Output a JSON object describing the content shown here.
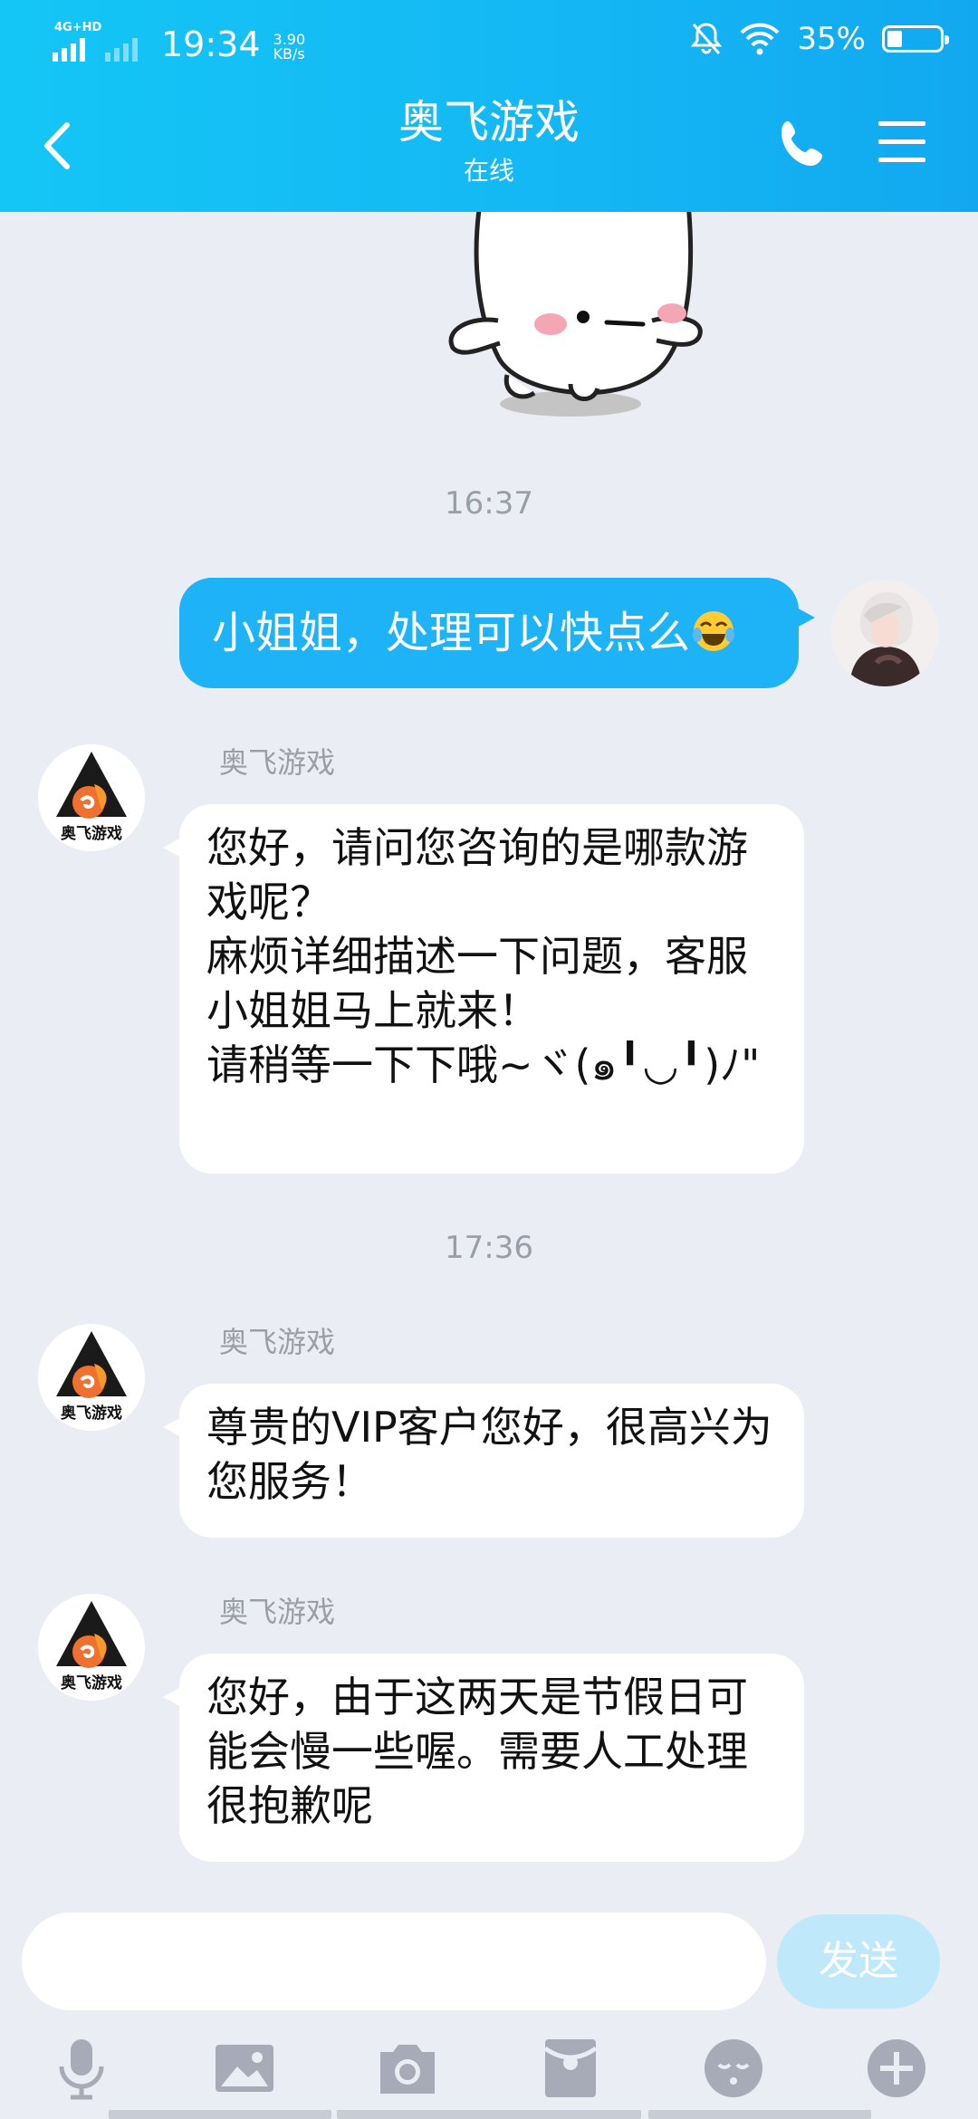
{
  "status_bar": {
    "network_label": "4G+HD",
    "time": "19:34",
    "speed_value": "3.90",
    "speed_unit": "KB/s",
    "battery_percent": "35%",
    "battery_level": 0.35
  },
  "header": {
    "title": "奥飞游戏",
    "subtitle": "在线"
  },
  "messages": [
    {
      "type": "timestamp",
      "text": "16:37"
    },
    {
      "type": "outgoing",
      "text": "小姐姐，处理可以快点么",
      "emoji": "joy-tears-emoji"
    },
    {
      "type": "incoming",
      "sender": "奥飞游戏",
      "text": "您好，请问您咨询的是哪款游戏呢？\n麻烦详细描述一下问题，客服小姐姐马上就来！\n请稍等一下下哦~ヾ(๑╹◡╹)ﾉ\""
    },
    {
      "type": "timestamp",
      "text": "17:36"
    },
    {
      "type": "incoming",
      "sender": "奥飞游戏",
      "text": "尊贵的VIP客户您好，很高兴为您服务！"
    },
    {
      "type": "incoming",
      "sender": "奥飞游戏",
      "text": "您好，由于这两天是节假日可能会慢一些喔。需要人工处理 很抱歉呢"
    }
  ],
  "avatar_logo_text": "奥飞游戏",
  "input": {
    "placeholder": "",
    "send_label": "发送"
  },
  "toolbar": [
    "microphone-icon",
    "image-icon",
    "camera-icon",
    "red-packet-icon",
    "emoji-icon",
    "plus-icon"
  ],
  "colors": {
    "header_bg": "#14b8f4",
    "outgoing_bubble": "#1db3f6",
    "incoming_bubble": "#ffffff",
    "chat_bg": "#eaedf4",
    "send_button": "#bfe9fb",
    "toolbar_icon": "#a7abb8"
  }
}
